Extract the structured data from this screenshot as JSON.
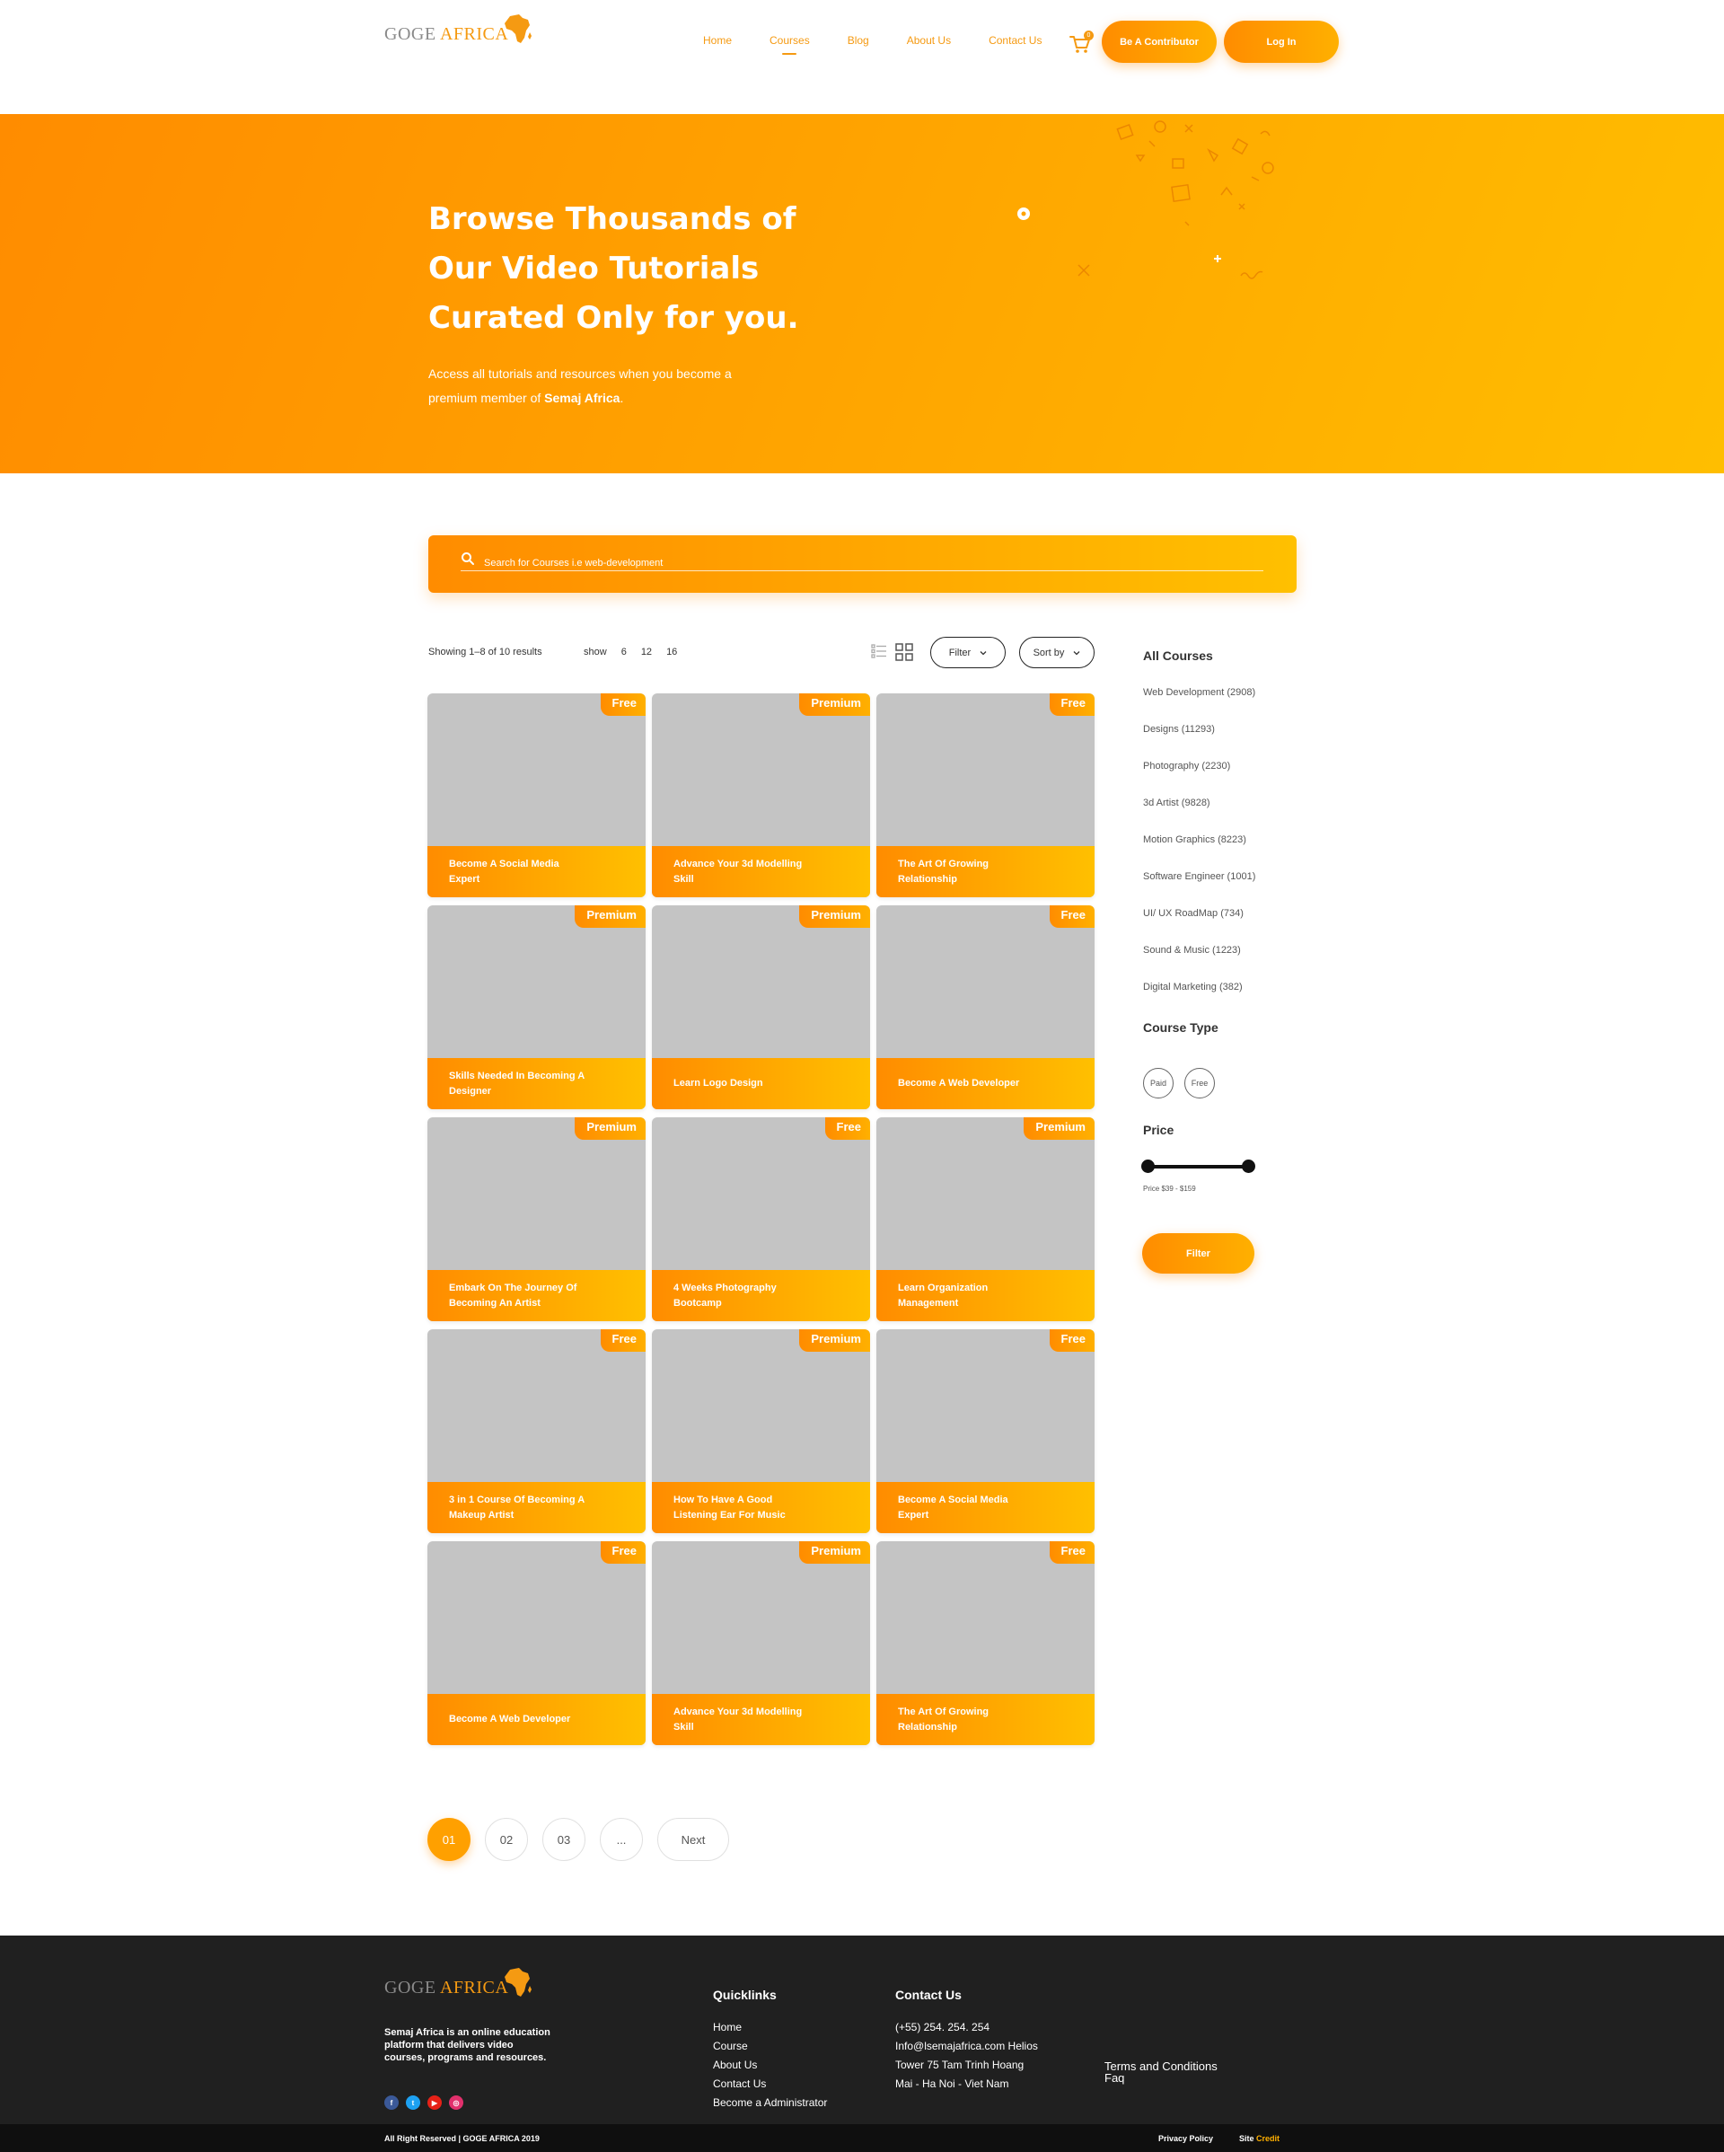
{
  "brand": {
    "logo_part1": "GOGE ",
    "logo_part2": "AFRICA",
    "accent_color": "#f59a12",
    "gradient_start": "#ff8c00",
    "gradient_end": "#ffc000"
  },
  "nav": {
    "items": [
      {
        "label": "Home"
      },
      {
        "label": "Courses"
      },
      {
        "label": "Blog"
      },
      {
        "label": "About Us"
      },
      {
        "label": "Contact Us"
      }
    ],
    "active": "Courses",
    "cart_icon": "cart-icon",
    "cart_count": "0",
    "contributor_button": "Be A Contributor",
    "login_button": "Log In"
  },
  "hero": {
    "title_line1": "Browse Thousands of",
    "title_line2": "Our Video Tutorials",
    "title_line3": "Curated Only for you.",
    "subtitle_part1": "Access all tutorials and resources when you become a premium member of ",
    "subtitle_bold": "Semaj Africa",
    "subtitle_end": "."
  },
  "search": {
    "placeholder": "Search for Courses i.e web-development",
    "icon": "search-icon"
  },
  "toolbar": {
    "showing": "Showing 1–8 of 10 results",
    "show_label": "show",
    "show_options": [
      "6",
      "12",
      "16"
    ],
    "filter_label": "Filter",
    "sort_label": "Sort by"
  },
  "courses": [
    {
      "title": "Become A Social Media Expert",
      "badge": "Free"
    },
    {
      "title": "Advance Your 3d Modelling Skill",
      "badge": "Premium"
    },
    {
      "title": "The Art Of Growing Relationship",
      "badge": "Free"
    },
    {
      "title": "Skills Needed In Becoming A Designer",
      "badge": "Premium"
    },
    {
      "title": "Learn Logo Design",
      "badge": "Premium"
    },
    {
      "title": "Become A Web Developer",
      "badge": "Free"
    },
    {
      "title": "Embark On The Journey Of Becoming An Artist",
      "badge": "Premium"
    },
    {
      "title": "4 Weeks Photography Bootcamp",
      "badge": "Free"
    },
    {
      "title": "Learn Organization Management",
      "badge": "Premium"
    },
    {
      "title": "3 in 1 Course Of Becoming A Makeup Artist",
      "badge": "Free"
    },
    {
      "title": "How To Have A Good Listening Ear For Music",
      "badge": "Premium"
    },
    {
      "title": "Become A Social Media Expert",
      "badge": "Free"
    },
    {
      "title": "Become A Web Developer",
      "badge": "Free"
    },
    {
      "title": "Advance Your 3d Modelling Skill",
      "badge": "Premium"
    },
    {
      "title": "The Art Of Growing Relationship",
      "badge": "Free"
    }
  ],
  "sidebar": {
    "all_courses_heading": "All Courses",
    "categories": [
      "Web Development (2908)",
      "Designs (11293)",
      "Photography (2230)",
      "3d Artist (9828)",
      "Motion Graphics (8223)",
      "Software Engineer (1001)",
      "UI/ UX RoadMap (734)",
      "Sound & Music (1223)",
      "Digital Marketing (382)"
    ],
    "course_type_heading": "Course Type",
    "course_types": [
      "Paid",
      "Free"
    ],
    "price_heading": "Price",
    "price_min": 39,
    "price_max": 159,
    "price_text": "Price $39 - $159",
    "filter_button": "Filter"
  },
  "pagination": {
    "pages": [
      "01",
      "02",
      "03",
      "..."
    ],
    "active": "01",
    "next_label": "Next"
  },
  "footer": {
    "logo_part1": "GOGE ",
    "logo_part2": "AFRICA",
    "about": "Semaj Africa is an online education platform that delivers video courses, programs and resources.",
    "socials": [
      "facebook-icon",
      "twitter-icon",
      "youtube-icon",
      "instagram-icon"
    ],
    "quicklinks_heading": "Quicklinks",
    "quicklinks": [
      "Home",
      "Course",
      "About Us",
      "Contact Us",
      "Become a Administrator"
    ],
    "contact_heading": "Contact Us",
    "contact_lines": [
      "(+55) 254. 254. 254",
      "Info@lsemajafrica.com Helios",
      "Tower 75 Tam Trinh Hoang",
      "Mai - Ha Noi - Viet Nam"
    ],
    "terms": "Terms and Conditions",
    "faq": "Faq",
    "copyright": "All Right Reserved | GOGE AFRICA 2019",
    "privacy": "Privacy Policy",
    "site_label": "Site ",
    "credit": "Credit"
  }
}
